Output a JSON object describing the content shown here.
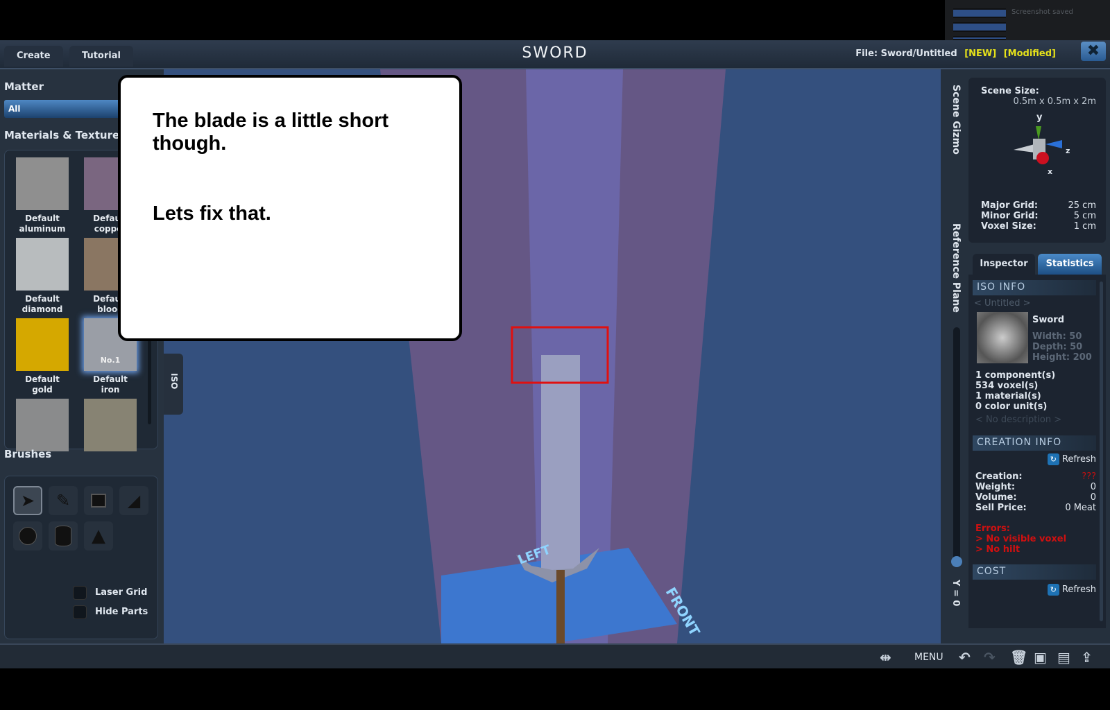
{
  "notification": {
    "text": "Screenshot saved"
  },
  "header": {
    "tabs": [
      "Create",
      "Tutorial"
    ],
    "title": "SWORD",
    "file_label": "File:",
    "file_name": "Sword/Untitled",
    "badge_new": "[NEW]",
    "badge_modified": "[Modified]"
  },
  "left": {
    "matter_label": "Matter",
    "matter_value": "All",
    "materials_label": "Materials & Textures",
    "materials": [
      {
        "line1": "Default",
        "line2": "aluminum",
        "color": "#8f8f8f"
      },
      {
        "line1": "Default",
        "line2": "copper",
        "color": "#7a6680"
      },
      {
        "line1": "Default",
        "line2": "diamond",
        "color": "#b8bcbe"
      },
      {
        "line1": "Default",
        "line2": "blood",
        "color": "#8a7662"
      },
      {
        "line1": "Default gold",
        "line2": "",
        "color": "#d5a800"
      },
      {
        "line1": "Default iron",
        "line2": "",
        "color": "#9a9ea6",
        "badge": "No.1",
        "selected": true
      },
      {
        "line1": "",
        "line2": "",
        "color": "#8a8b8c"
      },
      {
        "line1": "",
        "line2": "",
        "color": "#878373"
      }
    ],
    "brushes_label": "Brushes",
    "brushes": [
      "select-arrow",
      "pencil",
      "cube",
      "wedge",
      "sphere",
      "cylinder",
      "cone"
    ],
    "laser_grid": "Laser Grid",
    "hide_parts": "Hide Parts"
  },
  "viewport": {
    "iso_tab": "ISO",
    "left_label": "LEFT",
    "front_label": "FRONT",
    "y_value": "Y = 0"
  },
  "callout": {
    "line1": "The blade is a little short",
    "line2": "though.",
    "line3": "Lets fix that."
  },
  "right": {
    "scene_gizmo_tab": "Scene Gizmo",
    "reference_plane_tab": "Reference Plane",
    "scene_size_label": "Scene Size:",
    "scene_size": "0.5m x 0.5m x 2m",
    "axes": {
      "y": "y",
      "z": "z",
      "x": "x"
    },
    "major_grid_label": "Major Grid:",
    "major_grid": "25 cm",
    "minor_grid_label": "Minor Grid:",
    "minor_grid": "5 cm",
    "voxel_size_label": "Voxel Size:",
    "voxel_size": "1 cm",
    "tabs": [
      "Inspector",
      "Statistics"
    ],
    "active_tab": "Statistics",
    "iso_info": "ISO INFO",
    "untitled": "< Untitled >",
    "name": "Sword",
    "width": "Width: 50",
    "depth": "Depth: 50",
    "height": "Height: 200",
    "stats": [
      "1 component(s)",
      "534 voxel(s)",
      "1 material(s)",
      "0 color unit(s)"
    ],
    "no_description": "< No description >",
    "creation_info": "CREATION INFO",
    "refresh": "Refresh",
    "creation_label": "Creation:",
    "creation": "???",
    "weight_label": "Weight:",
    "weight": "0",
    "volume_label": "Volume:",
    "volume": "0",
    "sell_label": "Sell Price:",
    "sell": "0 Meat",
    "errors_label": "Errors:",
    "errors": [
      "> No visible voxel",
      "> No hilt"
    ],
    "cost": "COST"
  },
  "bottom": {
    "menu": "MENU"
  },
  "colors": {
    "accent": "#1e72b4",
    "error": "#e01010",
    "highlight": "#e6e21a"
  }
}
